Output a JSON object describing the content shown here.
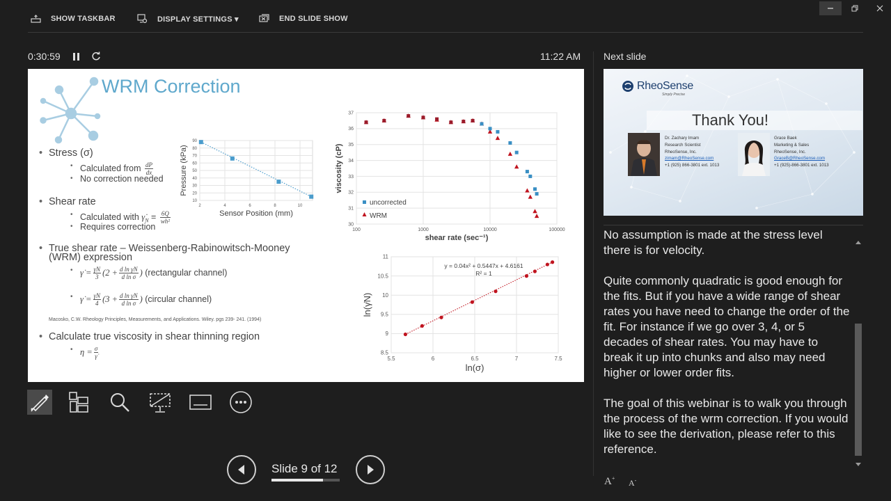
{
  "toolbar": {
    "show_taskbar": "SHOW TASKBAR",
    "display_settings": "DISPLAY SETTINGS ▾",
    "end_slide_show": "END SLIDE SHOW"
  },
  "presenter": {
    "elapsed_time": "0:30:59",
    "clock": "11:22 AM",
    "next_slide_label": "Next slide",
    "slide_counter": "Slide 9 of 12",
    "progress_fraction": 0.75
  },
  "current_slide": {
    "title": "WRM Correction",
    "bullets": {
      "stress": "Stress (σ)",
      "stress_calc": "Calculated from",
      "stress_dp": "dP",
      "stress_dx": "dx",
      "stress_nocorr": "No correction needed",
      "shear": "Shear rate",
      "shear_calc": "Calculated with",
      "shear_sym": "γ̇",
      "shear_sub": "N",
      "shear_eq": " = ",
      "shear_num": "6Q",
      "shear_den": "wh²",
      "shear_req": "Requires correction",
      "true_shear_1": "True shear rate – Weissenberg-Rabinowitsch-Mooney",
      "true_shear_2": "(WRM) expression",
      "rect_prefix": "γ̇ =",
      "rect_frac_num": "γ̇N",
      "rect_frac_den": "3",
      "rect_open": "(2 +",
      "rect_ln_num": "d ln γ̇N",
      "rect_ln_den": "d ln σ",
      "rect_close": ")",
      "rect_label": "(rectangular channel)",
      "circ_prefix": "γ̇ =",
      "circ_frac_num": "γ̇N",
      "circ_frac_den": "4",
      "circ_open": "(3 +",
      "circ_ln_num": "d ln γ̇N",
      "circ_ln_den": "d ln σ",
      "circ_close": ")",
      "circ_label": "(circular channel)",
      "reference": "Macosko, C.W. Rheology Principles, Measurements, and Applications. Wiley. pgs 239- 241. (1994)",
      "viscosity": "Calculate true viscosity in shear thinning region",
      "eta": "η =",
      "eta_num": "σ",
      "eta_den": "γ̇"
    }
  },
  "next_slide": {
    "logo_name": "RheoSense",
    "logo_tagline": "Simply Precise",
    "heading": "Thank You!",
    "people": [
      {
        "name": "Dr. Zachary Imam",
        "role": "Research Scientist",
        "company": "RheoSense, Inc.",
        "email": "zimam@RheoSense.com",
        "phone": "+1 (925) 866-3801 ext. 1013"
      },
      {
        "name": "Grace Baek",
        "role": "Marketing & Sales",
        "company": "RheoSense, Inc.",
        "email": "GraceB@RheoSense.com",
        "phone": "+1 (925)-866-3801 ext. 1013"
      }
    ]
  },
  "notes": {
    "partial_1": "No assumption is made at the stress level",
    "partial_2": "there is for velocity.",
    "para_2": "Quite commonly quadratic is good enough for the fits. But if you have a wide range of shear rates you have need to change the order of the fit. For instance if we go over 3, 4, or 5 decades of shear rates. You may have to break it up into chunks and also may need higher or lower order fits.",
    "para_3": "The goal of this webinar is to walk you through the process of the wrm correction. If you would like to see the derivation, please refer to this reference."
  },
  "colors": {
    "title_blue": "#5fa8cc",
    "uncorrected_blue": "#3a8fc4",
    "wrm_red": "#c0141f",
    "pressure_point": "#4a9ccc",
    "fit_red": "#c0141f"
  },
  "chart_data": [
    {
      "type": "scatter",
      "title": "",
      "xlabel": "Sensor Position (mm)",
      "ylabel": "Pressure (kPa)",
      "xlim": [
        2,
        11
      ],
      "ylim": [
        10,
        90
      ],
      "xticks": [
        2,
        4,
        6,
        8,
        10
      ],
      "yticks": [
        10,
        20,
        30,
        40,
        50,
        60,
        70,
        80,
        90
      ],
      "x": [
        2.1,
        4.6,
        8.3,
        10.9
      ],
      "y": [
        88,
        66,
        35,
        15
      ],
      "trendline": "linear"
    },
    {
      "type": "scatter",
      "title": "",
      "xlabel": "shear rate (sec⁻¹)",
      "ylabel": "viscosity (cP)",
      "xscale": "log",
      "xlim": [
        100,
        100000
      ],
      "ylim": [
        30,
        37
      ],
      "xticks": [
        "100",
        "1000",
        "10000",
        "100000"
      ],
      "yticks": [
        30,
        31,
        32,
        33,
        34,
        35,
        36,
        37
      ],
      "legend_position": "bottom-left",
      "series": [
        {
          "name": "uncorrected",
          "marker": "square",
          "x": [
            140,
            260,
            600,
            1000,
            1600,
            2600,
            4000,
            5500,
            7500,
            10000,
            13000,
            20000,
            25000,
            36000,
            40000,
            47000,
            50000
          ],
          "y": [
            36.4,
            36.5,
            36.8,
            36.7,
            36.6,
            36.4,
            36.45,
            36.5,
            36.3,
            36.0,
            35.8,
            35.1,
            34.5,
            33.3,
            33.0,
            32.2,
            31.9
          ]
        },
        {
          "name": "WRM",
          "marker": "triangle",
          "x": [
            140,
            260,
            600,
            1000,
            1600,
            2600,
            4000,
            5500,
            7500,
            10000,
            13000,
            20000,
            25000,
            36000,
            40000,
            47000,
            50000
          ],
          "y": [
            36.4,
            36.5,
            36.8,
            36.7,
            36.55,
            36.4,
            36.45,
            36.5,
            36.3,
            35.8,
            35.4,
            34.4,
            33.6,
            32.1,
            31.7,
            30.8,
            30.5
          ]
        }
      ]
    },
    {
      "type": "scatter",
      "title": "",
      "xlabel": "ln(σ)",
      "ylabel": "ln(γ̇N)",
      "xlim": [
        5.5,
        7.5
      ],
      "ylim": [
        8.5,
        11
      ],
      "xticks": [
        5.5,
        6,
        6.5,
        7,
        7.5
      ],
      "yticks": [
        8.5,
        9,
        9.5,
        10,
        10.5,
        11
      ],
      "annotation": [
        "y = 0.04x² + 0.5447x + 4.6161",
        "R² = 1"
      ],
      "trendline": "polynomial",
      "x": [
        5.67,
        5.87,
        6.1,
        6.47,
        6.75,
        7.12,
        7.22,
        7.37,
        7.43
      ],
      "y": [
        8.98,
        9.2,
        9.42,
        9.82,
        10.1,
        10.5,
        10.62,
        10.8,
        10.86
      ]
    }
  ]
}
